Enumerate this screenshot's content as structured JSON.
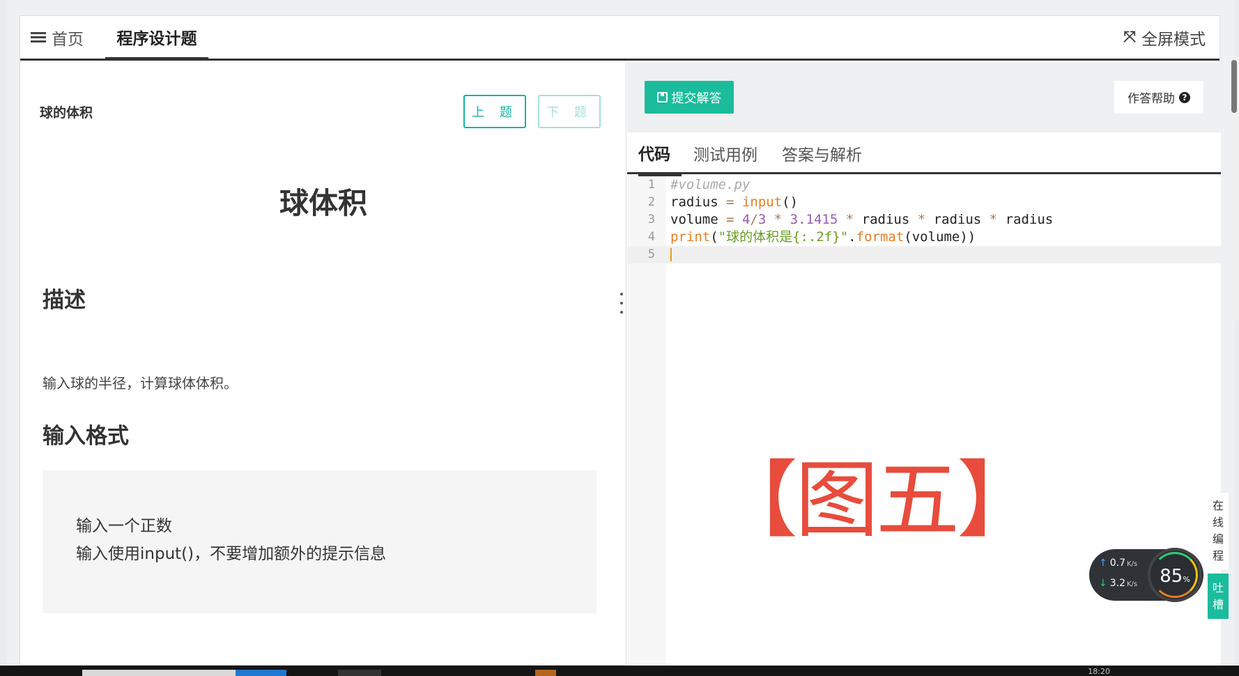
{
  "topbar": {
    "home_label": "首页",
    "active_tab_label": "程序设计题",
    "fullscreen_label": "全屏模式"
  },
  "question": {
    "short_title": "球的体积",
    "prev_label": "上 题",
    "next_label": "下 题",
    "main_title": "球体积",
    "desc_heading": "描述",
    "desc_text": "输入球的半径，计算球体体积。",
    "input_heading": "输入格式",
    "input_lines": [
      "输入一个正数",
      "输入使用input()，不要增加额外的提示信息"
    ]
  },
  "editor_toolbar": {
    "submit_label": "提交解答",
    "help_label": "作答帮助"
  },
  "code_tabs": [
    "代码",
    "测试用例",
    "答案与解析"
  ],
  "code": {
    "line_numbers": [
      "1",
      "2",
      "3",
      "4",
      "5"
    ],
    "line1_comment": "#volume.py",
    "line2": {
      "var": "radius",
      "eq": " = ",
      "fn": "input",
      "paren": "()"
    },
    "line3": {
      "var": "volume",
      "eq": " = ",
      "n1": "4",
      "op1": "/",
      "n2": "3",
      "op2": " * ",
      "n3": "3.1415",
      "op3": " * ",
      "v1": "radius",
      "op4": " * ",
      "v2": "radius",
      "op5": " * ",
      "v3": "radius"
    },
    "line4": {
      "fn": "print",
      "p1": "(",
      "str": "\"球的体积是{:.2f}\"",
      "dot": ".",
      "method": "format",
      "args": "(volume))"
    }
  },
  "watermark": "【图五】",
  "side_widgets": {
    "online_chars": [
      "在",
      "线",
      "编",
      "程"
    ],
    "feedback_chars": [
      "吐",
      "槽"
    ]
  },
  "net_monitor": {
    "up_value": "0.7",
    "down_value": "3.2",
    "unit": "K/s",
    "percent": "85",
    "percent_sign": "%"
  },
  "taskbar": {
    "clock": "18:20"
  }
}
